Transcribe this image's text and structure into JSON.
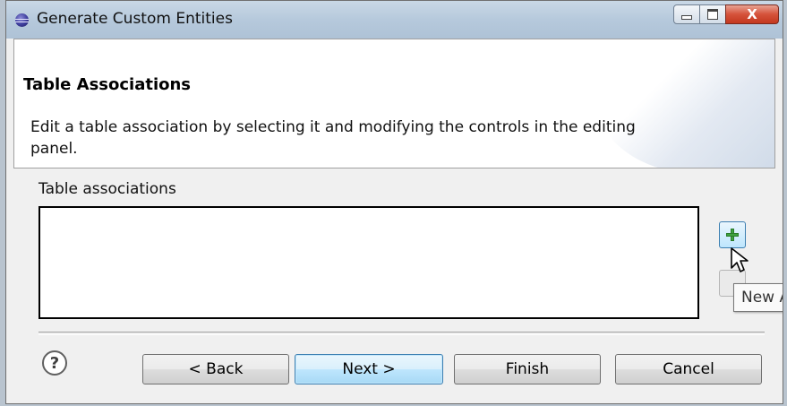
{
  "window": {
    "title": "Generate Custom Entities",
    "controls": {
      "minimize": "–",
      "maximize": "□",
      "close": "X"
    }
  },
  "header": {
    "title": "Table Associations",
    "description": "Edit a table association by selecting it and modifying the controls in the editing panel."
  },
  "content": {
    "list_label": "Table associations",
    "items": [],
    "add_button_icon": "plus-icon",
    "tooltip": "New A"
  },
  "footer": {
    "help_icon": "?",
    "back_label": "< Back",
    "next_label": "Next >",
    "finish_label": "Finish",
    "cancel_label": "Cancel"
  },
  "colors": {
    "titlebar": "#b6c9dc",
    "close_button": "#c3381f",
    "default_button": "#bee6fd",
    "plus_icon": "#3fa33f"
  }
}
